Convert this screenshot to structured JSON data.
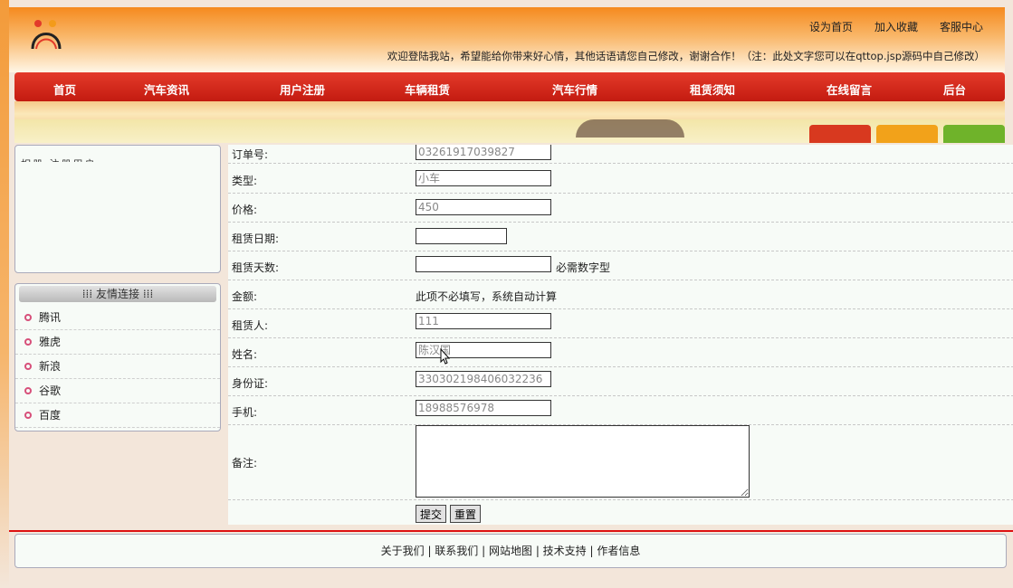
{
  "site": {
    "top_links": [
      "设为首页",
      "加入收藏",
      "客服中心"
    ],
    "welcome": "欢迎登陆我站，希望能给你带来好心情，其他话语请您自己修改，谢谢合作！（注：此处文字您可以在qttop.jsp源码中自己修改）"
  },
  "nav": [
    "首页",
    "汽车资讯",
    "用户注册",
    "车辆租赁",
    "汽车行情",
    "租赁须知",
    "在线留言",
    "后台"
  ],
  "sidebar": {
    "login_partial": "相册    注册用户",
    "links_title": "友情连接",
    "links": [
      "腾讯",
      "雅虎",
      "新浪",
      "谷歌",
      "百度"
    ]
  },
  "form": {
    "order_no": {
      "label": "订单号:",
      "value": "03261917039827"
    },
    "type": {
      "label": "类型:",
      "value": "小车"
    },
    "price": {
      "label": "价格:",
      "value": "450"
    },
    "rent_date": {
      "label": "租赁日期:",
      "value": ""
    },
    "rent_days": {
      "label": "租赁天数:",
      "value": "",
      "hint": "必需数字型"
    },
    "amount": {
      "label": "金额:",
      "text": "此项不必填写，系统自动计算"
    },
    "renter": {
      "label": "租赁人:",
      "value": "111"
    },
    "name": {
      "label": "姓名:",
      "value": "陈汉国"
    },
    "id_card": {
      "label": "身份证:",
      "value": "330302198406032236"
    },
    "phone": {
      "label": "手机:",
      "value": "18988576978"
    },
    "remark": {
      "label": "备注:",
      "value": ""
    },
    "submit": "提交",
    "reset": "重置"
  },
  "footer": [
    "关于我们",
    "联系我们",
    "网站地图",
    "技术支持",
    "作者信息"
  ],
  "colors": {
    "nav_red": "#d42a1c",
    "header_orange": "#f58a1e",
    "accent_pink": "#d7507a"
  }
}
